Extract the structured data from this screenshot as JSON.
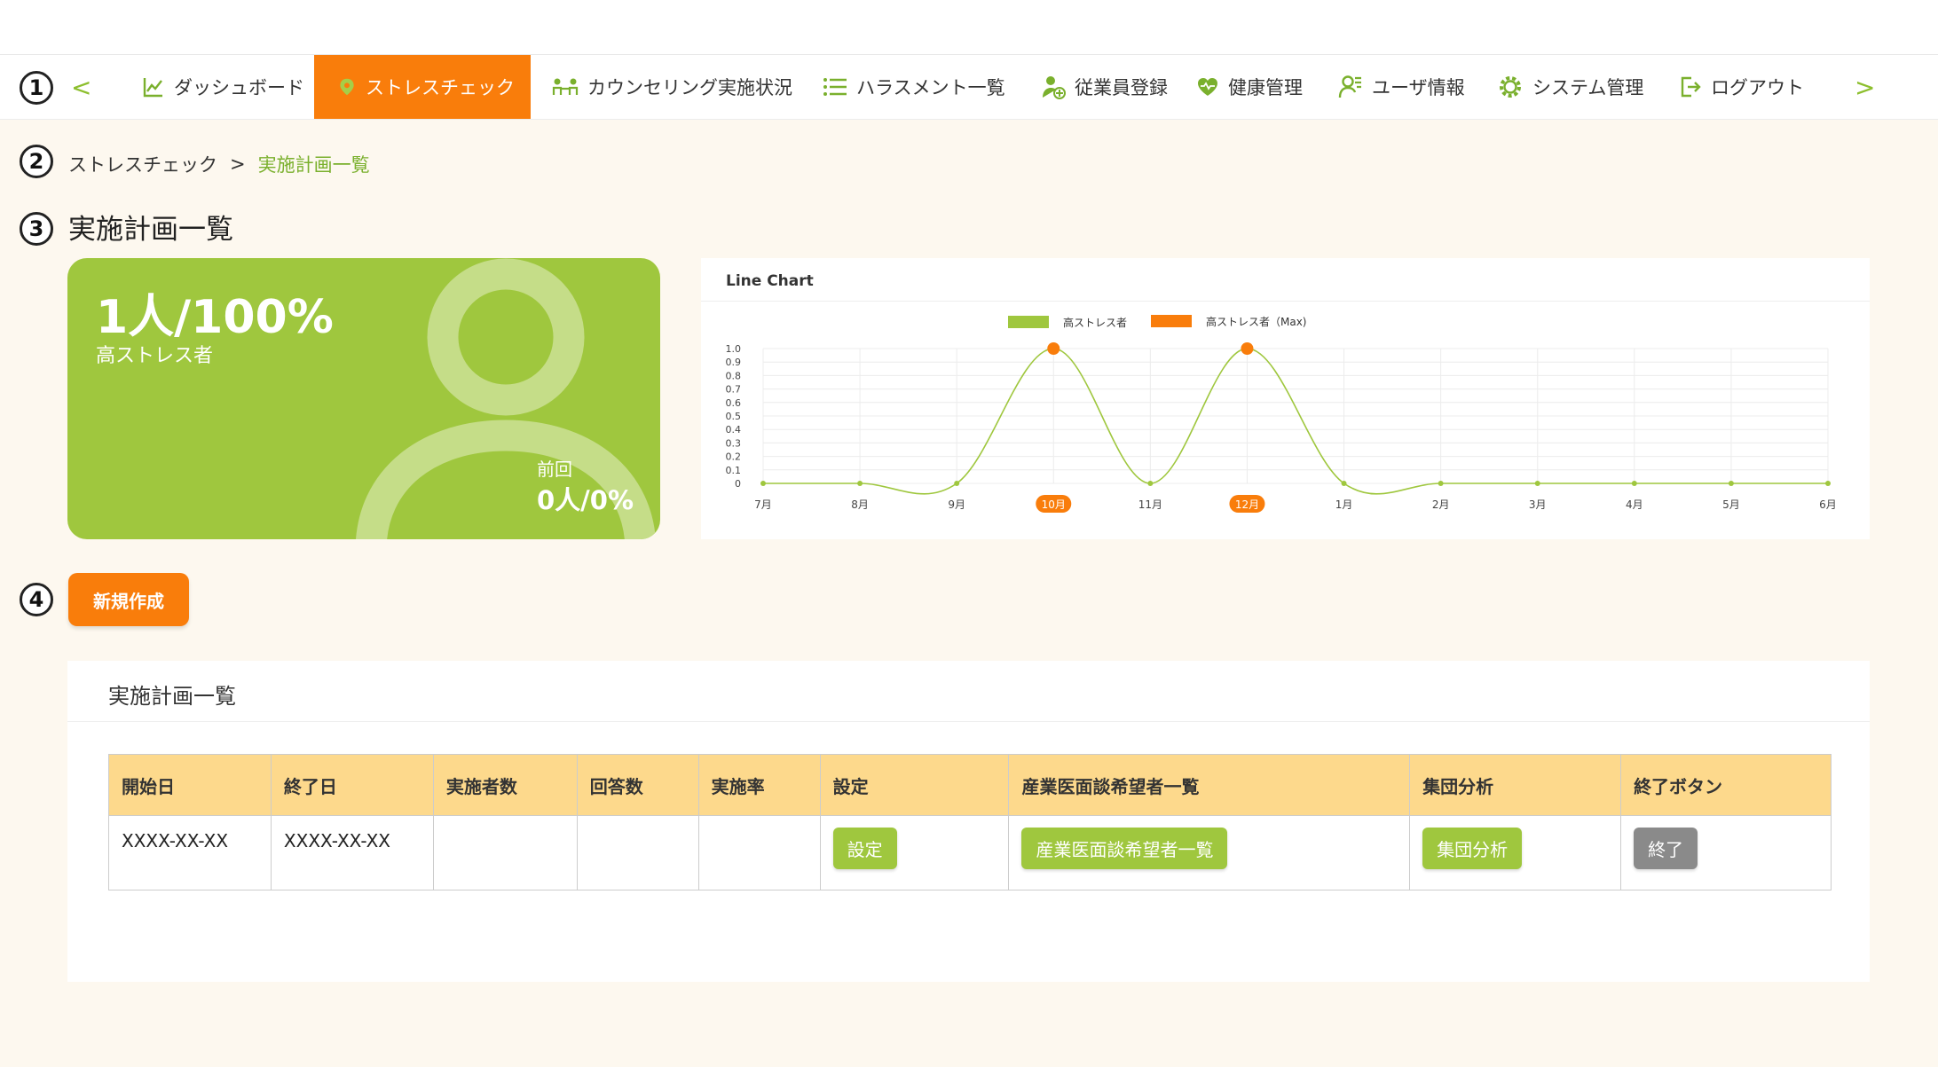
{
  "markers": {
    "nav": "1",
    "breadcrumb": "2",
    "title": "3",
    "actions": "4"
  },
  "nav": {
    "prev": "<",
    "next": ">",
    "items": [
      {
        "label": "ダッシュボード",
        "icon": "chart-line-icon"
      },
      {
        "label": "ストレスチェック",
        "icon": "location-pin-icon",
        "active": true
      },
      {
        "label": "カウンセリング実施状況",
        "icon": "counseling-icon"
      },
      {
        "label": "ハラスメント一覧",
        "icon": "list-icon"
      },
      {
        "label": "従業員登録",
        "icon": "user-add-icon"
      },
      {
        "label": "健康管理",
        "icon": "heart-icon"
      },
      {
        "label": "ユーザ情報",
        "icon": "user-info-icon"
      },
      {
        "label": "システム管理",
        "icon": "gear-icon"
      },
      {
        "label": "ログアウト",
        "icon": "logout-icon"
      }
    ]
  },
  "breadcrumb": {
    "parent": "ストレスチェック",
    "sep": ">",
    "current": "実施計画一覧"
  },
  "page_title": "実施計画一覧",
  "stat": {
    "value": "1人/100%",
    "label": "高ストレス者",
    "prev_label": "前回",
    "prev_value": "0人/0%"
  },
  "chart_data": {
    "type": "line",
    "title": "Line Chart",
    "categories": [
      "7月",
      "8月",
      "9月",
      "10月",
      "11月",
      "12月",
      "1月",
      "2月",
      "3月",
      "4月",
      "5月",
      "6月"
    ],
    "highlighted_categories": [
      "10月",
      "12月"
    ],
    "series": [
      {
        "name": "高ストレス者",
        "values": [
          0,
          0,
          0,
          1,
          0,
          1,
          0,
          0,
          0,
          0,
          0,
          0
        ],
        "color": "#9fc73e"
      },
      {
        "name": "高ストレス者（Max)",
        "values": [
          null,
          null,
          null,
          1,
          null,
          1,
          null,
          null,
          null,
          null,
          null,
          null
        ],
        "color": "#f97d0b"
      }
    ],
    "yticks": [
      "0",
      "0.1",
      "0.2",
      "0.3",
      "0.4",
      "0.5",
      "0.6",
      "0.7",
      "0.8",
      "0.9",
      "1.0"
    ],
    "ylim": [
      0,
      1
    ],
    "grid": true,
    "legend_position": "top-center"
  },
  "actions": {
    "new_label": "新規作成"
  },
  "list": {
    "title": "実施計画一覧",
    "headers": [
      "開始日",
      "終了日",
      "実施者数",
      "回答数",
      "実施率",
      "設定",
      "産業医面談希望者一覧",
      "集団分析",
      "終了ボタン"
    ],
    "rows": [
      {
        "start": "XXXX-XX-XX",
        "end": "XXXX-XX-XX",
        "participants": "",
        "answers": "",
        "rate": "",
        "settings_btn": "設定",
        "interview_btn": "産業医面談希望者一覧",
        "analysis_btn": "集団分析",
        "end_btn": "終了"
      }
    ]
  },
  "colors": {
    "accent": "#f97d0b",
    "green": "#9fc73e",
    "table_header": "#fdd98c",
    "background": "#fdf8ef"
  }
}
